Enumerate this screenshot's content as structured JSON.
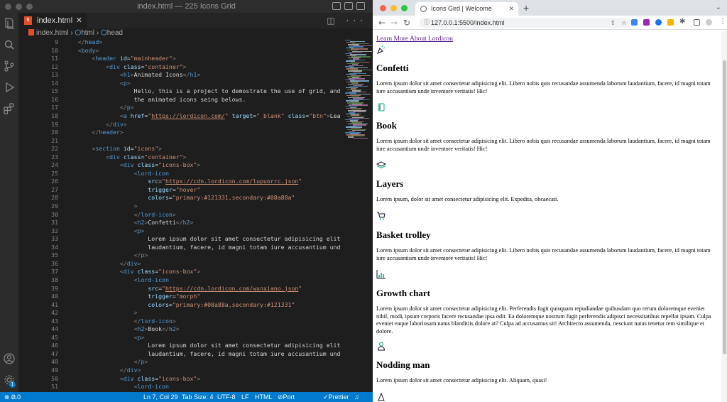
{
  "vscode": {
    "title": "index.html — 225 Icons Grid",
    "tab_label": "index.html",
    "tab_badge": "5",
    "breadcrumb": [
      "index.html",
      "html",
      "head"
    ],
    "line_numbers": [
      "9",
      "10",
      "11",
      "12",
      "13",
      "14",
      "15",
      "16",
      "17",
      "18",
      "19",
      "20",
      "21",
      "22",
      "23",
      "24",
      "25",
      "26",
      "27",
      "28",
      "29",
      "30",
      "31",
      "32",
      "33",
      "34",
      "35",
      "36",
      "37",
      "38",
      "39",
      "40",
      "41",
      "42",
      "43",
      "44",
      "45",
      "46",
      "47",
      "48",
      "49",
      "50",
      "51"
    ],
    "code_lines": [
      [
        [
          "pu",
          "    </"
        ],
        [
          "tg",
          "head"
        ],
        [
          "pu",
          ">"
        ]
      ],
      [
        [
          "pu",
          "    <"
        ],
        [
          "tg",
          "body"
        ],
        [
          "pu",
          ">"
        ]
      ],
      [
        [
          "tx",
          "        "
        ],
        [
          "pu",
          "<"
        ],
        [
          "tg",
          "header"
        ],
        [
          "tx",
          " "
        ],
        [
          "at",
          "id"
        ],
        [
          "tx",
          "="
        ],
        [
          "sv",
          "\"mainheader\""
        ],
        [
          "pu",
          ">"
        ]
      ],
      [
        [
          "tx",
          "            "
        ],
        [
          "pu",
          "<"
        ],
        [
          "tg",
          "div"
        ],
        [
          "tx",
          " "
        ],
        [
          "at",
          "class"
        ],
        [
          "tx",
          "="
        ],
        [
          "sv",
          "\"container\""
        ],
        [
          "pu",
          ">"
        ]
      ],
      [
        [
          "tx",
          "                "
        ],
        [
          "pu",
          "<"
        ],
        [
          "tg",
          "h1"
        ],
        [
          "pu",
          ">"
        ],
        [
          "tx",
          "Animated Icons"
        ],
        [
          "pu",
          "</"
        ],
        [
          "tg",
          "h1"
        ],
        [
          "pu",
          ">"
        ]
      ],
      [
        [
          "tx",
          "                "
        ],
        [
          "pu",
          "<"
        ],
        [
          "tg",
          "p"
        ],
        [
          "pu",
          ">"
        ]
      ],
      [
        [
          "tx",
          "                    Hello, this is a project to demostrate the use of grid, and as a par"
        ]
      ],
      [
        [
          "tx",
          "                    the animated icons seing belows."
        ]
      ],
      [
        [
          "tx",
          "                "
        ],
        [
          "pu",
          "</"
        ],
        [
          "tg",
          "p"
        ],
        [
          "pu",
          ">"
        ]
      ],
      [
        [
          "tx",
          "                "
        ],
        [
          "pu",
          "<"
        ],
        [
          "tg",
          "a"
        ],
        [
          "tx",
          " "
        ],
        [
          "at",
          "href"
        ],
        [
          "tx",
          "="
        ],
        [
          "sv",
          "\""
        ],
        [
          "ul",
          "https://lordicon.com/"
        ],
        [
          "sv",
          "\""
        ],
        [
          "tx",
          " "
        ],
        [
          "at",
          "target"
        ],
        [
          "tx",
          "="
        ],
        [
          "sv",
          "\"_blank\""
        ],
        [
          "tx",
          " "
        ],
        [
          "at",
          "class"
        ],
        [
          "tx",
          "="
        ],
        [
          "sv",
          "\"btn\""
        ],
        [
          "pu",
          ">"
        ],
        [
          "tx",
          "Learn More A"
        ]
      ],
      [
        [
          "tx",
          "            "
        ],
        [
          "pu",
          "</"
        ],
        [
          "tg",
          "div"
        ],
        [
          "pu",
          ">"
        ]
      ],
      [
        [
          "tx",
          "        "
        ],
        [
          "pu",
          "</"
        ],
        [
          "tg",
          "header"
        ],
        [
          "pu",
          ">"
        ]
      ],
      [
        [
          "tx",
          ""
        ]
      ],
      [
        [
          "tx",
          "        "
        ],
        [
          "pu",
          "<"
        ],
        [
          "tg",
          "section"
        ],
        [
          "tx",
          " "
        ],
        [
          "at",
          "id"
        ],
        [
          "tx",
          "="
        ],
        [
          "sv",
          "\"icons\""
        ],
        [
          "pu",
          ">"
        ]
      ],
      [
        [
          "tx",
          "            "
        ],
        [
          "pu",
          "<"
        ],
        [
          "tg",
          "div"
        ],
        [
          "tx",
          " "
        ],
        [
          "at",
          "class"
        ],
        [
          "tx",
          "="
        ],
        [
          "sv",
          "\"container\""
        ],
        [
          "pu",
          ">"
        ]
      ],
      [
        [
          "tx",
          "                "
        ],
        [
          "pu",
          "<"
        ],
        [
          "tg",
          "div"
        ],
        [
          "tx",
          " "
        ],
        [
          "at",
          "class"
        ],
        [
          "tx",
          "="
        ],
        [
          "sv",
          "\"icons-box\""
        ],
        [
          "pu",
          ">"
        ]
      ],
      [
        [
          "tx",
          "                    "
        ],
        [
          "pu",
          "<"
        ],
        [
          "tg",
          "lord-icon"
        ]
      ],
      [
        [
          "tx",
          "                        "
        ],
        [
          "at",
          "src"
        ],
        [
          "tx",
          "="
        ],
        [
          "sv",
          "\""
        ],
        [
          "ul",
          "https://cdn.lordicon.com/lupuorrc.json"
        ],
        [
          "sv",
          "\""
        ]
      ],
      [
        [
          "tx",
          "                        "
        ],
        [
          "at",
          "trigger"
        ],
        [
          "tx",
          "="
        ],
        [
          "sv",
          "\"hover\""
        ]
      ],
      [
        [
          "tx",
          "                        "
        ],
        [
          "at",
          "colors"
        ],
        [
          "tx",
          "="
        ],
        [
          "sv",
          "\"primary:#121331,secondary:#08a88a\""
        ]
      ],
      [
        [
          "tx",
          "                    "
        ],
        [
          "pu",
          ">"
        ]
      ],
      [
        [
          "tx",
          "                    "
        ],
        [
          "pu",
          "</"
        ],
        [
          "tg",
          "lord-icon"
        ],
        [
          "pu",
          ">"
        ]
      ],
      [
        [
          "tx",
          "                    "
        ],
        [
          "pu",
          "<"
        ],
        [
          "tg",
          "h2"
        ],
        [
          "pu",
          ">"
        ],
        [
          "tx",
          "Confetti"
        ],
        [
          "pu",
          "</"
        ],
        [
          "tg",
          "h2"
        ],
        [
          "pu",
          ">"
        ]
      ],
      [
        [
          "tx",
          "                    "
        ],
        [
          "pu",
          "<"
        ],
        [
          "tg",
          "p"
        ],
        [
          "pu",
          ">"
        ]
      ],
      [
        [
          "tx",
          "                        Lorem ipsum dolor sit amet consectetur adipisicing elit. Libero"
        ]
      ],
      [
        [
          "tx",
          "                        laudantium, facere, id magni totam iure accusantium unde invento"
        ]
      ],
      [
        [
          "tx",
          "                    "
        ],
        [
          "pu",
          "</"
        ],
        [
          "tg",
          "p"
        ],
        [
          "pu",
          ">"
        ]
      ],
      [
        [
          "tx",
          "                "
        ],
        [
          "pu",
          "</"
        ],
        [
          "tg",
          "div"
        ],
        [
          "pu",
          ">"
        ]
      ],
      [
        [
          "tx",
          "                "
        ],
        [
          "pu",
          "<"
        ],
        [
          "tg",
          "div"
        ],
        [
          "tx",
          " "
        ],
        [
          "at",
          "class"
        ],
        [
          "tx",
          "="
        ],
        [
          "sv",
          "\"icons-box\""
        ],
        [
          "pu",
          ">"
        ]
      ],
      [
        [
          "tx",
          "                    "
        ],
        [
          "pu",
          "<"
        ],
        [
          "tg",
          "lord-icon"
        ]
      ],
      [
        [
          "tx",
          "                        "
        ],
        [
          "at",
          "src"
        ],
        [
          "tx",
          "="
        ],
        [
          "sv",
          "\""
        ],
        [
          "ul",
          "https://cdn.lordicon.com/wxnxiano.json"
        ],
        [
          "sv",
          "\""
        ]
      ],
      [
        [
          "tx",
          "                        "
        ],
        [
          "at",
          "trigger"
        ],
        [
          "tx",
          "="
        ],
        [
          "sv",
          "\"morph\""
        ]
      ],
      [
        [
          "tx",
          "                        "
        ],
        [
          "at",
          "colors"
        ],
        [
          "tx",
          "="
        ],
        [
          "sv",
          "\"primary:#08a88a,secondary:#121331\""
        ]
      ],
      [
        [
          "tx",
          "                    "
        ],
        [
          "pu",
          ">"
        ]
      ],
      [
        [
          "tx",
          "                    "
        ],
        [
          "pu",
          "</"
        ],
        [
          "tg",
          "lord-icon"
        ],
        [
          "pu",
          ">"
        ]
      ],
      [
        [
          "tx",
          "                    "
        ],
        [
          "pu",
          "<"
        ],
        [
          "tg",
          "h2"
        ],
        [
          "pu",
          ">"
        ],
        [
          "tx",
          "Book"
        ],
        [
          "pu",
          "</"
        ],
        [
          "tg",
          "h2"
        ],
        [
          "pu",
          ">"
        ]
      ],
      [
        [
          "tx",
          "                    "
        ],
        [
          "pu",
          "<"
        ],
        [
          "tg",
          "p"
        ],
        [
          "pu",
          ">"
        ]
      ],
      [
        [
          "tx",
          "                        Lorem ipsum dolor sit amet consectetur adipisicing elit. Libero"
        ]
      ],
      [
        [
          "tx",
          "                        laudantium, facere, id magni totam iure accusantium unde invento"
        ]
      ],
      [
        [
          "tx",
          "                    "
        ],
        [
          "pu",
          "</"
        ],
        [
          "tg",
          "p"
        ],
        [
          "pu",
          ">"
        ]
      ],
      [
        [
          "tx",
          "                "
        ],
        [
          "pu",
          "</"
        ],
        [
          "tg",
          "div"
        ],
        [
          "pu",
          ">"
        ]
      ],
      [
        [
          "tx",
          "                "
        ],
        [
          "pu",
          "<"
        ],
        [
          "tg",
          "div"
        ],
        [
          "tx",
          " "
        ],
        [
          "at",
          "class"
        ],
        [
          "tx",
          "="
        ],
        [
          "sv",
          "\"icons-box\""
        ],
        [
          "pu",
          ">"
        ]
      ],
      [
        [
          "tx",
          "                    "
        ],
        [
          "pu",
          "<"
        ],
        [
          "tg",
          "lord-icon"
        ]
      ]
    ],
    "status": {
      "errors": "0",
      "warnings": "0",
      "position": "Ln 7, Col 29",
      "tab_size": "Tab Size: 4",
      "encoding": "UTF-8",
      "eol": "LF",
      "language": "HTML",
      "port": "Port : 5500",
      "prettier": "Prettier"
    },
    "accounts_badge": "1"
  },
  "browser": {
    "tab_title": "Icons Gird | Welcome",
    "url": "127.0.0.1:5500/index.html",
    "page": {
      "link": "Learn More About Lordicon",
      "items": [
        {
          "icon": "confetti-icon",
          "title": "Confetti",
          "text": "Lorem ipsum dolor sit amet consectetur adipisicing elit. Libero nobis quis recusandae assumenda laborum laudantium, facere, id magni totam iure accusantium unde inventore veritatis! Hic!"
        },
        {
          "icon": "book-icon",
          "title": "Book",
          "text": "Lorem ipsum dolor sit amet consectetur adipisicing elit. Libero nobis quis recusandae assumenda laborum laudantium, facere, id magni totam iure accusantium unde inventore veritatis! Hic!"
        },
        {
          "icon": "layers-icon",
          "title": "Layers",
          "text": "Lorem ipsum, dolor sit amet consectetur adipisicing elit. Expedita, obcaecati."
        },
        {
          "icon": "basket-trolley-icon",
          "title": "Basket trolley",
          "text": "Lorem ipsum dolor sit amet consectetur adipisicing elit. Libero nobis quis recusandae assumenda laborum laudantium, facere, id magni totam iure accusantium unde inventore veritatis! Hic!"
        },
        {
          "icon": "growth-chart-icon",
          "title": "Growth chart",
          "text": "Lorem ipsum dolor sit amet consectetur adipisicing elit. Perferendis fugit quisquam repudiandae quibusdam quo rerum doloremque eveniet nihil, modi, ipsum corporis facere recusandae ipsa odit. Ea doloremque nostrum fugit perferendis adipisci necessitatibus repellat ipsam. Culpa eveniet eaque laboriosam natus blanditiis dolore at? Culpa ad accusamus sit! Architecto assumenda, nesciunt natus tenetur rem similique et dolore."
        },
        {
          "icon": "nodding-man-icon",
          "title": "Nodding man",
          "text": "Lorem ipsum dolor sit amet consectetur adipisicing elit. Aliquam, quasi!"
        }
      ]
    }
  },
  "colors": {
    "accent": "#007acc",
    "icon_primary": "#121331",
    "icon_secondary": "#08a88a",
    "link_visited": "#551a8b"
  }
}
